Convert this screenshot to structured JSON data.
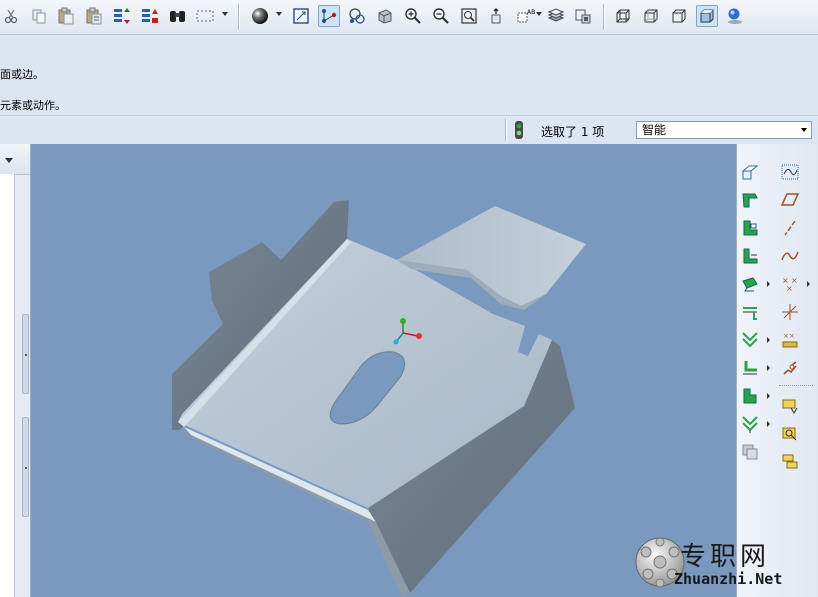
{
  "toolbar": {
    "buttons": [
      {
        "name": "cut-icon"
      },
      {
        "name": "copy-icon"
      },
      {
        "name": "paste-icon"
      },
      {
        "name": "paste-special-icon"
      },
      {
        "name": "regenerate-icon"
      },
      {
        "name": "regen-manager-icon"
      },
      {
        "name": "find-icon"
      },
      {
        "name": "select-box-icon"
      },
      {
        "name": "appearance-sphere-icon"
      },
      {
        "name": "refit-icon"
      },
      {
        "name": "datum-display-icon"
      },
      {
        "name": "spin-center-icon"
      },
      {
        "name": "orient-icon"
      },
      {
        "name": "zoom-in-icon"
      },
      {
        "name": "zoom-out-icon"
      },
      {
        "name": "refit-zoom-icon"
      },
      {
        "name": "reorient-icon"
      },
      {
        "name": "saved-views-icon"
      },
      {
        "name": "layers-icon"
      },
      {
        "name": "view-manager-icon"
      },
      {
        "name": "wireframe-icon"
      },
      {
        "name": "hidden-line-icon"
      },
      {
        "name": "no-hidden-icon"
      },
      {
        "name": "shading-icon"
      },
      {
        "name": "render-icon"
      }
    ]
  },
  "messages": {
    "line1": "面或边。",
    "line2": "元素或动作。"
  },
  "status": {
    "selection_text": "选取了 1 项",
    "filter_value": "智能"
  },
  "feature_toolbar": {
    "left_column": [
      "flat-wall-icon",
      "flange-wall-icon",
      "unattached-wall-icon",
      "extend-wall-icon",
      "bend-icon",
      "edge-bend-icon",
      "unbend-icon",
      "bend-back-icon",
      "form-icon",
      "flatten-icon",
      "merge-icon"
    ],
    "right_column": [
      "datum-plane-icon",
      "datum-sketch-icon",
      "datum-axis-icon",
      "datum-curve-icon",
      "datum-point-icon",
      "coordinate-system-icon",
      "analysis-icon",
      "rip-icon",
      "insert-form-icon",
      "edit-definition-icon",
      "convert-icon"
    ]
  },
  "watermark": {
    "title": "专职网",
    "url": "Zhuanzhi.Net"
  },
  "colors": {
    "viewport_background": "#7b98bf",
    "part_top": "#b5c3d0",
    "part_side": "#6d7a87"
  }
}
